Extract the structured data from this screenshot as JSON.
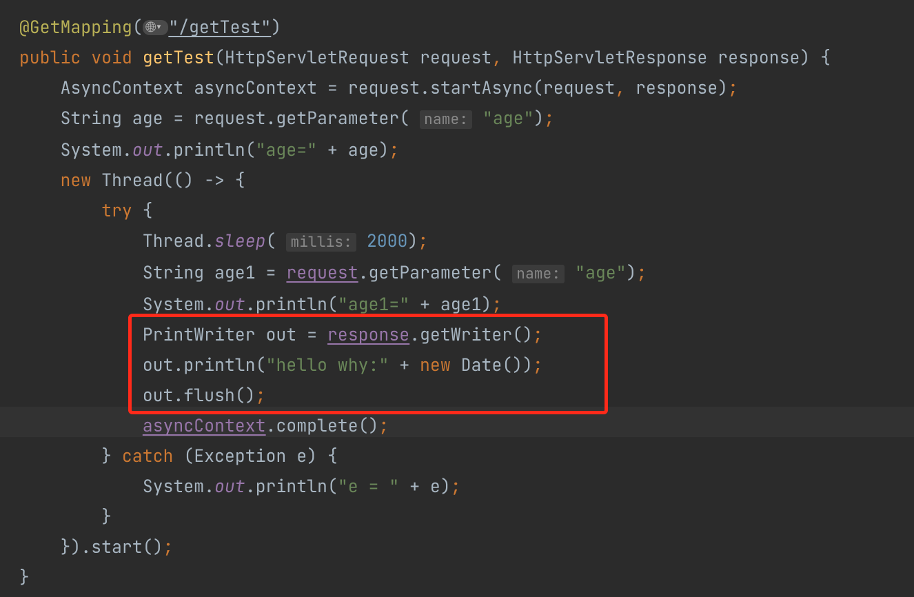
{
  "colors": {
    "background": "#2b2b2b",
    "annotation": "#b9b156",
    "keyword": "#cc7832",
    "method_def": "#ffc66d",
    "string": "#6a8759",
    "number": "#6897bb",
    "field_italic": "#9876aa",
    "highlight_box": "#ff2a1a"
  },
  "gutter": {
    "web_icon": "🌐▾"
  },
  "code": {
    "l1": {
      "annot": "@GetMapping",
      "path": "\"/getTest\""
    },
    "l2": {
      "kw_public": "public",
      "kw_void": "void",
      "method": "getTest",
      "param1_type": "HttpServletRequest",
      "param1_name": "request",
      "param2_type": "HttpServletResponse",
      "param2_name": "response"
    },
    "l3": {
      "type": "AsyncContext",
      "var": "asyncContext",
      "expr_pre": "request.startAsync(request",
      "expr_mid": ", ",
      "expr_post": "response)"
    },
    "l4": {
      "type": "String",
      "var": "age",
      "call_pre": "request.getParameter(",
      "hint": "name:",
      "arg": "\"age\"",
      "call_post": ")"
    },
    "l5": {
      "cls": "System.",
      "field": "out",
      "call": ".println(",
      "str": "\"age=\"",
      "plus": " + age)"
    },
    "l6": {
      "kw_new": "new",
      "type": "Thread",
      "lambda": "(() -> {"
    },
    "l7": {
      "kw_try": "try",
      "brace": " {"
    },
    "l8": {
      "cls": "Thread.",
      "method": "sleep",
      "open": "(",
      "hint": "millis:",
      "num": "2000",
      "close": ")"
    },
    "l9": {
      "type": "String",
      "var": "age1",
      "eq": " = ",
      "ref": "request",
      "call": ".getParameter(",
      "hint": "name:",
      "arg": "\"age\"",
      "close": ")"
    },
    "l10": {
      "cls": "System.",
      "field": "out",
      "call": ".println(",
      "str": "\"age1=\"",
      "plus": " + age1)"
    },
    "l11": {
      "type": "PrintWriter",
      "var": "out",
      "eq": " = ",
      "ref": "response",
      "call": ".getWriter()"
    },
    "l12": {
      "obj": "out.println(",
      "str": "\"hello why:\"",
      "plus": " + ",
      "kw_new": "new",
      "call2": " Date())"
    },
    "l13": {
      "stmt": "out.flush()"
    },
    "l14": {
      "ref": "asyncContext",
      "call": ".complete()"
    },
    "l15": {
      "brace_close": "}",
      "kw_catch": "catch",
      "paren": " (Exception e) {"
    },
    "l16": {
      "cls": "System.",
      "field": "out",
      "call": ".println(",
      "str": "\"e = \"",
      "plus": " + e)"
    },
    "l17": {
      "brace": "}"
    },
    "l18": {
      "tail": "}).start()"
    },
    "l19": {
      "brace": "}"
    }
  },
  "semi": ";"
}
